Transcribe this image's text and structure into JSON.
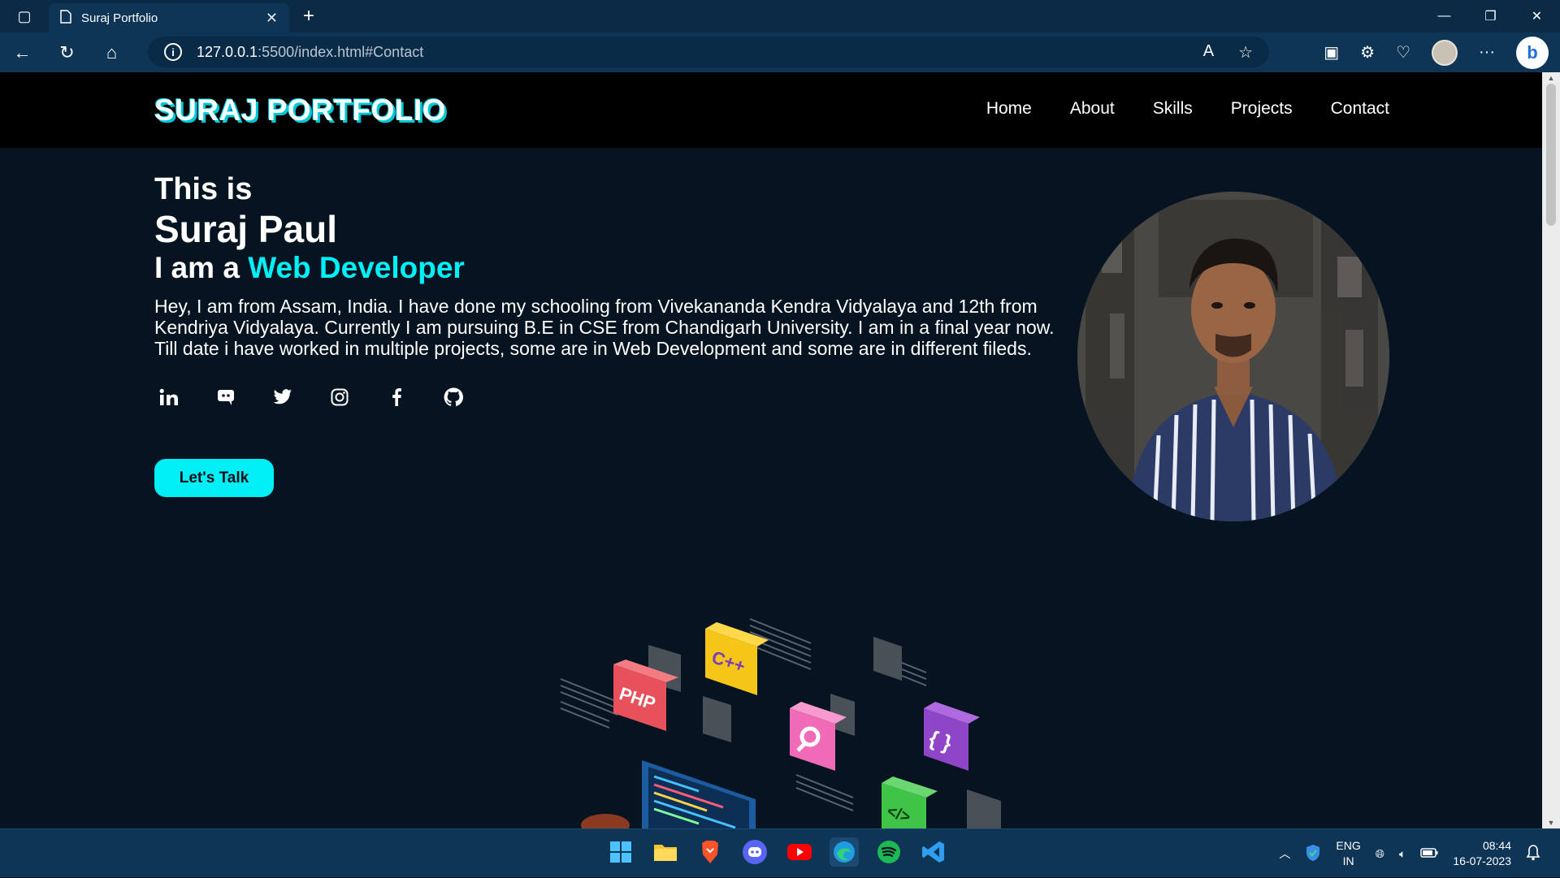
{
  "browser": {
    "tab_title": "Suraj Portfolio",
    "url_host": "127.0.0.1",
    "url_rest": ":5500/index.html#Contact"
  },
  "site": {
    "logo": "SURAJ PORTFOLIO",
    "nav": [
      "Home",
      "About",
      "Skills",
      "Projects",
      "Contact"
    ],
    "hero": {
      "line1": "This is",
      "name": "Suraj Paul",
      "role_prefix": "I am a",
      "role": "Web Developer",
      "bio": "Hey, I am from Assam, India. I have done my schooling from Vivekananda Kendra Vidyalaya and 12th from Kendriya Vidyalaya. Currently I am pursuing B.E in CSE from Chandigarh University. I am in a final year now. Till date i have worked in multiple projects, some are in Web Development and some are in different fileds.",
      "cta": "Let's Talk",
      "socials": [
        "linkedin-icon",
        "discord-icon",
        "twitter-icon",
        "instagram-icon",
        "facebook-icon",
        "github-icon"
      ]
    },
    "illustration_labels": [
      "PHP",
      "C++",
      "{ }",
      "</>"
    ]
  },
  "taskbar": {
    "lang_line1": "ENG",
    "lang_line2": "IN",
    "time": "08:44",
    "date": "16-07-2023"
  },
  "colors": {
    "accent": "#00eef5",
    "page_bg": "#061320",
    "header_bg": "#000000",
    "browser_chrome": "#0e3556"
  }
}
